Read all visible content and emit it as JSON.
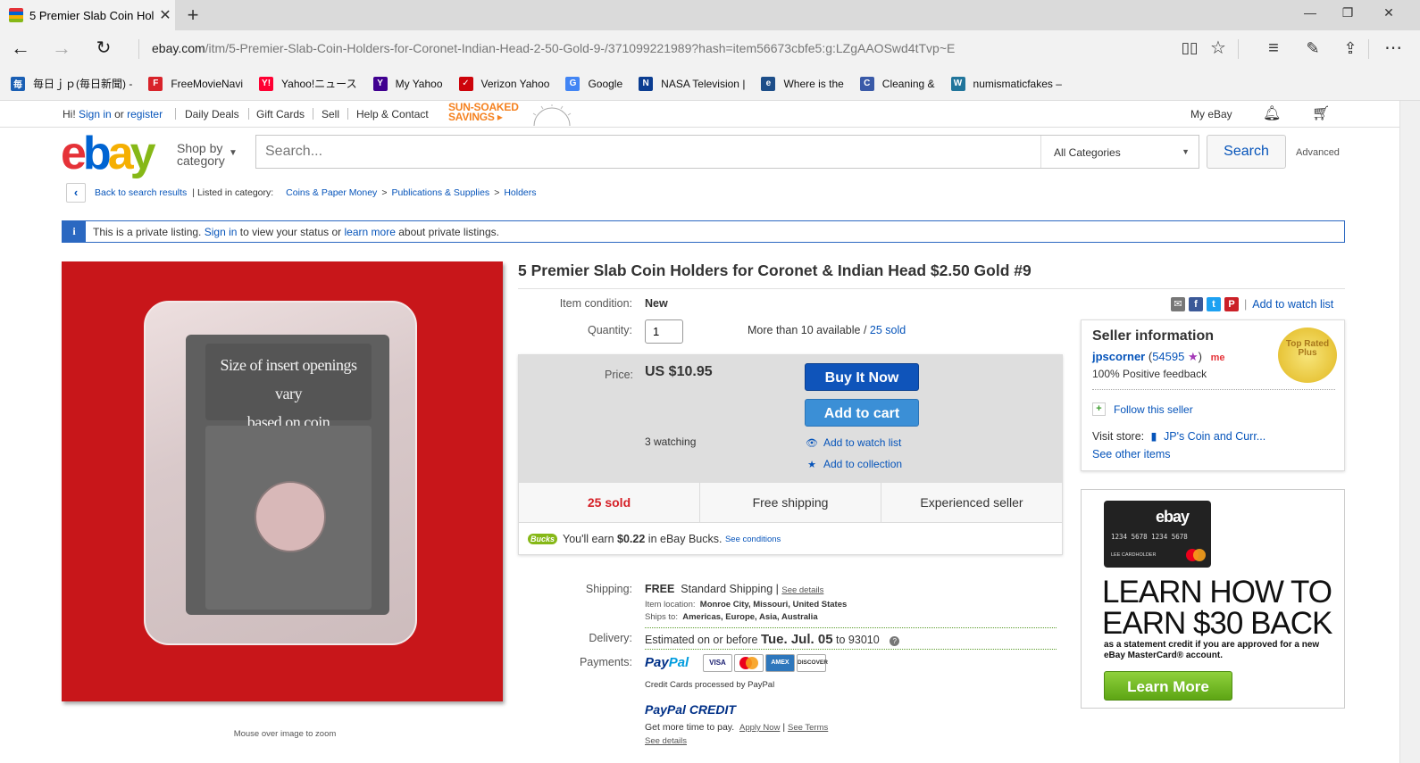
{
  "browser": {
    "tab_title": "5 Premier Slab Coin Hol",
    "url_host": "ebay.com",
    "url_path": "/itm/5-Premier-Slab-Coin-Holders-for-Coronet-Indian-Head-2-50-Gold-9-/371099221989?hash=item56673cbfe5:g:LZgAAOSwd4tTvp~E"
  },
  "favorites": [
    {
      "label": "毎日ｊｐ(毎日新聞) -",
      "icon": "mainichi-icon",
      "color": "#1a5fb4",
      "glyph": "毎"
    },
    {
      "label": "FreeMovieNavi",
      "icon": "freemovienavi-icon",
      "color": "#d8232a",
      "glyph": "F"
    },
    {
      "label": "Yahoo!ニュース",
      "icon": "yahoo-news-icon",
      "color": "#ff0033",
      "glyph": "Y!"
    },
    {
      "label": "My Yahoo",
      "icon": "yahoo-icon",
      "color": "#400090",
      "glyph": "Y"
    },
    {
      "label": "Verizon Yahoo",
      "icon": "verizon-icon",
      "color": "#cd040b",
      "glyph": "✓"
    },
    {
      "label": "Google",
      "icon": "google-icon",
      "color": "#4285f4",
      "glyph": "G"
    },
    {
      "label": "NASA Television |",
      "icon": "nasa-icon",
      "color": "#0b3d91",
      "glyph": "N"
    },
    {
      "label": "Where is the",
      "icon": "where-icon",
      "color": "#1d4e89",
      "glyph": "e"
    },
    {
      "label": "Cleaning &",
      "icon": "cleaning-icon",
      "color": "#3a5aa8",
      "glyph": "C"
    },
    {
      "label": "numismaticfakes –",
      "icon": "wordpress-icon",
      "color": "#21759b",
      "glyph": "W"
    }
  ],
  "header": {
    "hi": "Hi!",
    "sign_in": "Sign in",
    "or": "or",
    "register": "register",
    "daily_deals": "Daily Deals",
    "gift_cards": "Gift Cards",
    "sell": "Sell",
    "help": "Help & Contact",
    "promo_line1": "SUN-SOAKED",
    "promo_line2": "SAVINGS ▸",
    "my_ebay": "My eBay"
  },
  "search": {
    "shop_by_1": "Shop by",
    "shop_by_2": "category",
    "placeholder": "Search...",
    "category": "All Categories",
    "button": "Search",
    "advanced": "Advanced"
  },
  "breadcrumb": {
    "back": "Back to search results",
    "listed_in": "| Listed in category:",
    "c1": "Coins & Paper Money",
    "c2": "Publications & Supplies",
    "c3": "Holders"
  },
  "private_notice": {
    "t1": "This is a private listing.",
    "sign_in": "Sign in",
    "t2": "to view your status or",
    "learn_more": "learn more",
    "t3": "about private listings."
  },
  "image": {
    "label_line1": "Size of insert openings vary",
    "label_line2": "based on coin denomination",
    "zoom_hint": "Mouse over image to zoom"
  },
  "item": {
    "title": "5 Premier Slab Coin Holders for Coronet & Indian Head $2.50 Gold #9",
    "condition_label": "Item condition:",
    "condition": "New",
    "quantity_label": "Quantity:",
    "quantity": "1",
    "available": "More than 10 available /",
    "sold_link": "25 sold",
    "price_label": "Price:",
    "price": "US $10.95",
    "buy_now": "Buy It Now",
    "add_to_cart": "Add to cart",
    "watching": "3 watching",
    "add_watch": "Add to watch list",
    "add_collection": "Add to collection",
    "sold": "25 sold",
    "free_shipping": "Free shipping",
    "experienced": "Experienced seller",
    "bucks_badge": "Bucks",
    "bucks_text1": "You'll earn",
    "bucks_amount": "$0.22",
    "bucks_text2": "in eBay Bucks.",
    "bucks_conditions": "See conditions",
    "add_watch_top": "Add to watch list"
  },
  "shipping": {
    "label": "Shipping:",
    "free": "FREE",
    "method": "Standard Shipping",
    "see_details": "See details",
    "location_label": "Item location:",
    "location": "Monroe City, Missouri, United States",
    "ships_label": "Ships to:",
    "ships_to": "Americas, Europe, Asia, Australia",
    "delivery_label": "Delivery:",
    "estimated": "Estimated on or before",
    "date": "Tue. Jul. 05",
    "to_zip": "to 93010",
    "payments_label": "Payments:",
    "paypal": "PayPal",
    "cards": [
      "VISA",
      "MC",
      "AMEX",
      "DISCOVER"
    ],
    "credit_note": "Credit Cards processed by PayPal",
    "pp_credit": "PayPal CREDIT",
    "more_time": "Get more time to pay.",
    "apply_now": "Apply Now",
    "see_terms": "See Terms",
    "see_details2": "See details"
  },
  "seller": {
    "title": "Seller information",
    "name": "jpscorner",
    "feedback": "54595",
    "positive": "100% Positive feedback",
    "badge": "Top Rated Plus",
    "follow": "Follow this seller",
    "visit_store": "Visit store:",
    "store": "JP's Coin and Curr...",
    "other_items": "See other items"
  },
  "ad": {
    "card_brand": "ebay",
    "card_number": "1234 5678 1234 5678",
    "card_name": "LEE CARDHOLDER",
    "headline1": "LEARN HOW TO",
    "headline2": "EARN $30 BACK",
    "sub": "as a statement credit if you are approved for a new eBay MasterCard® account.",
    "button": "Learn More"
  }
}
